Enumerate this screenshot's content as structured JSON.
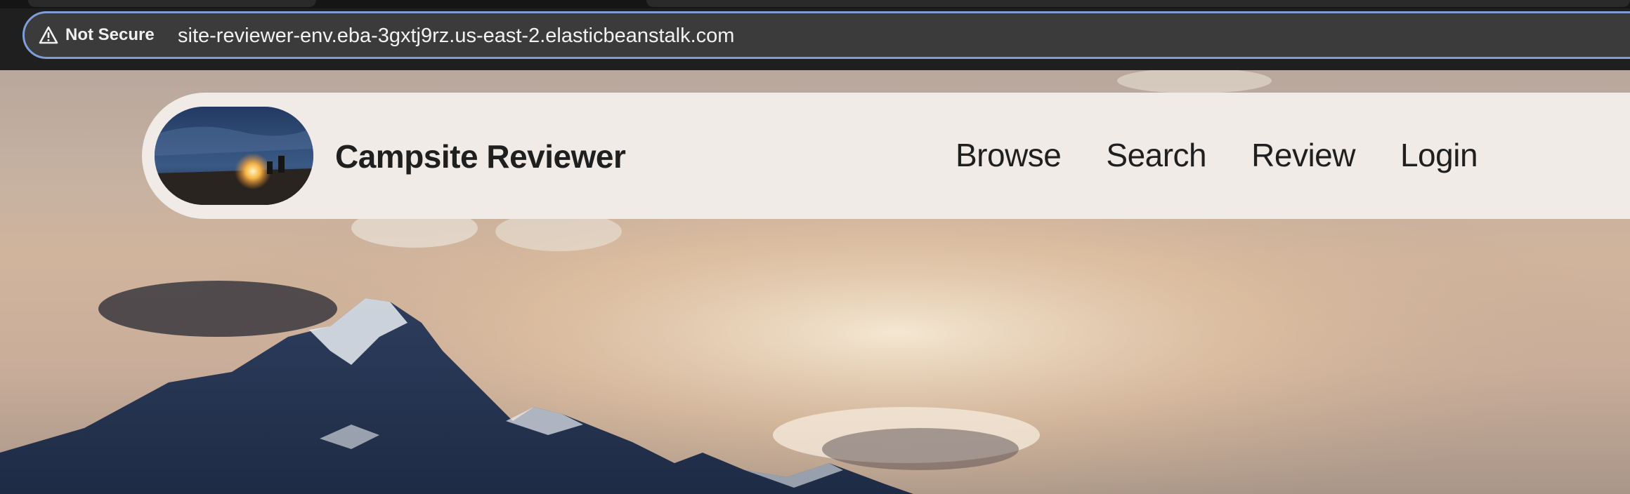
{
  "browser": {
    "security_label": "Not Secure",
    "url": "site-reviewer-env.eba-3gxtj9rz.us-east-2.elasticbeanstalk.com",
    "accent_color": "#7f9ed8"
  },
  "site": {
    "title": "Campsite Reviewer",
    "nav": [
      {
        "label": "Browse"
      },
      {
        "label": "Search"
      },
      {
        "label": "Review"
      },
      {
        "label": "Login"
      }
    ]
  },
  "icons": {
    "security": "warning-triangle-icon"
  }
}
